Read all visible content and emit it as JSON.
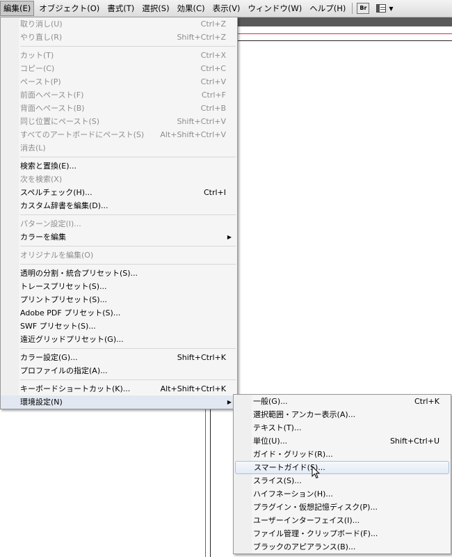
{
  "menubar": {
    "items": [
      {
        "label": "編集(E)",
        "active": true
      },
      {
        "label": "オブジェクト(O)"
      },
      {
        "label": "書式(T)"
      },
      {
        "label": "選択(S)"
      },
      {
        "label": "効果(C)"
      },
      {
        "label": "表示(V)"
      },
      {
        "label": "ウィンドウ(W)"
      },
      {
        "label": "ヘルプ(H)"
      }
    ],
    "bridge_label": "Br",
    "workspace_icon": "workspace-layout-icon"
  },
  "edit_menu": {
    "groups": [
      [
        {
          "label": "取り消し(U)",
          "shortcut": "Ctrl+Z",
          "disabled": true
        },
        {
          "label": "やり直し(R)",
          "shortcut": "Shift+Ctrl+Z",
          "disabled": true
        }
      ],
      [
        {
          "label": "カット(T)",
          "shortcut": "Ctrl+X",
          "disabled": true
        },
        {
          "label": "コピー(C)",
          "shortcut": "Ctrl+C",
          "disabled": true
        },
        {
          "label": "ペースト(P)",
          "shortcut": "Ctrl+V",
          "disabled": true
        },
        {
          "label": "前面へペースト(F)",
          "shortcut": "Ctrl+F",
          "disabled": true
        },
        {
          "label": "背面へペースト(B)",
          "shortcut": "Ctrl+B",
          "disabled": true
        },
        {
          "label": "同じ位置にペースト(S)",
          "shortcut": "Shift+Ctrl+V",
          "disabled": true
        },
        {
          "label": "すべてのアートボードにペースト(S)",
          "shortcut": "Alt+Shift+Ctrl+V",
          "disabled": true
        },
        {
          "label": "消去(L)",
          "shortcut": "",
          "disabled": true
        }
      ],
      [
        {
          "label": "検索と置換(E)...",
          "shortcut": ""
        },
        {
          "label": "次を検索(X)",
          "shortcut": "",
          "disabled": true
        },
        {
          "label": "スペルチェック(H)...",
          "shortcut": "Ctrl+I"
        },
        {
          "label": "カスタム辞書を編集(D)...",
          "shortcut": ""
        }
      ],
      [
        {
          "label": "パターン設定(I)...",
          "shortcut": "",
          "disabled": true
        },
        {
          "label": "カラーを編集",
          "shortcut": "",
          "submenu": true
        }
      ],
      [
        {
          "label": "オリジナルを編集(O)",
          "shortcut": "",
          "disabled": true
        }
      ],
      [
        {
          "label": "透明の分割・統合プリセット(S)...",
          "shortcut": ""
        },
        {
          "label": "トレースプリセット(S)...",
          "shortcut": ""
        },
        {
          "label": "プリントプリセット(S)...",
          "shortcut": ""
        },
        {
          "label": "Adobe PDF プリセット(S)...",
          "shortcut": ""
        },
        {
          "label": "SWF プリセット(S)...",
          "shortcut": ""
        },
        {
          "label": "遠近グリッドプリセット(G)...",
          "shortcut": ""
        }
      ],
      [
        {
          "label": "カラー設定(G)...",
          "shortcut": "Shift+Ctrl+K"
        },
        {
          "label": "プロファイルの指定(A)...",
          "shortcut": ""
        }
      ],
      [
        {
          "label": "キーボードショートカット(K)...",
          "shortcut": "Alt+Shift+Ctrl+K"
        },
        {
          "label": "環境設定(N)",
          "shortcut": "",
          "submenu": true,
          "highlighted": true
        }
      ]
    ]
  },
  "prefs_menu": {
    "items": [
      {
        "label": "一般(G)...",
        "shortcut": "Ctrl+K"
      },
      {
        "label": "選択範囲・アンカー表示(A)...",
        "shortcut": ""
      },
      {
        "label": "テキスト(T)...",
        "shortcut": ""
      },
      {
        "label": "単位(U)...",
        "shortcut": "Shift+Ctrl+U"
      },
      {
        "label": "ガイド・グリッド(R)...",
        "shortcut": ""
      },
      {
        "label": "スマートガイド(S)...",
        "shortcut": "",
        "highlighted": true
      },
      {
        "label": "スライス(S)...",
        "shortcut": ""
      },
      {
        "label": "ハイフネーション(H)...",
        "shortcut": ""
      },
      {
        "label": "プラグイン・仮想記憶ディスク(P)...",
        "shortcut": ""
      },
      {
        "label": "ユーザーインターフェイス(I)...",
        "shortcut": ""
      },
      {
        "label": "ファイル管理・クリップボード(F)...",
        "shortcut": ""
      },
      {
        "label": "ブラックのアピアランス(B)...",
        "shortcut": ""
      }
    ]
  }
}
